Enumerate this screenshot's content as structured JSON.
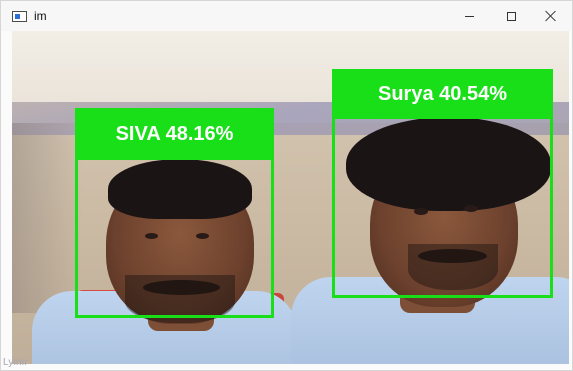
{
  "window": {
    "title": "im",
    "icon": "window-app-icon",
    "controls": {
      "minimize_icon": "minimize-icon",
      "maximize_icon": "maximize-icon",
      "close_icon": "close-icon"
    }
  },
  "image": {
    "detections": [
      {
        "label": "SIVA 48.16%",
        "box_color": "#18df18",
        "text_color": "#ffffff"
      },
      {
        "label": "Surya 40.54%",
        "box_color": "#18df18",
        "text_color": "#ffffff"
      }
    ]
  },
  "bottom_text": "Lyinir"
}
